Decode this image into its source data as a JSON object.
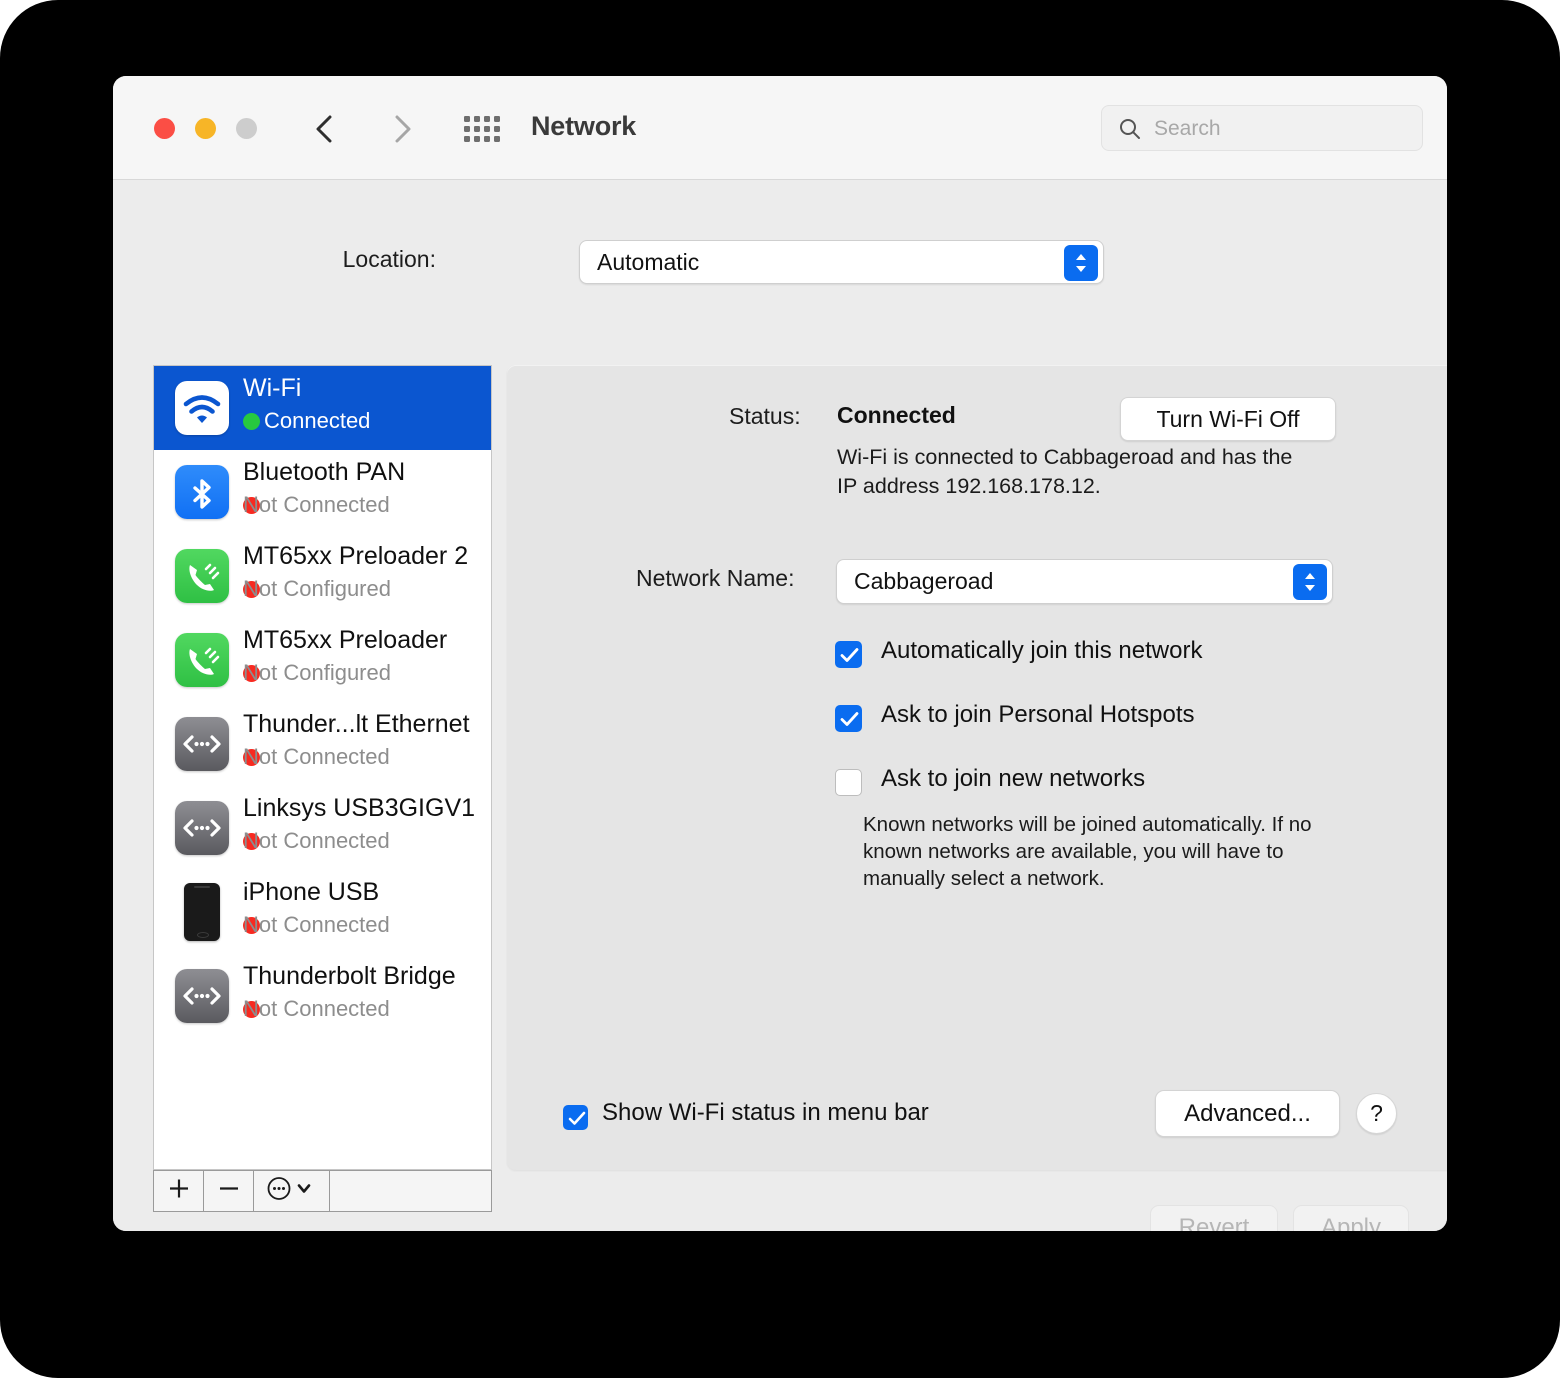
{
  "window": {
    "title": "Network",
    "traffic_lights": [
      "close",
      "minimize",
      "zoom"
    ],
    "accent_color": "#0a6cf0",
    "selection_color": "#0b56d0"
  },
  "search": {
    "placeholder": "Search",
    "value": ""
  },
  "location": {
    "label": "Location:",
    "value": "Automatic"
  },
  "sidebar": {
    "services": [
      {
        "name": "Wi-Fi",
        "status": "Connected",
        "status_color": "#27c93f",
        "icon": "wifi-icon",
        "selected": true
      },
      {
        "name": "Bluetooth PAN",
        "status": "Not Connected",
        "status_color": "#f72a21",
        "icon": "bluetooth-icon",
        "selected": false
      },
      {
        "name": "MT65xx Preloader 2",
        "status": "Not Configured",
        "status_color": "#f72a21",
        "icon": "phone-modem-icon",
        "selected": false
      },
      {
        "name": "MT65xx Preloader",
        "status": "Not Configured",
        "status_color": "#f72a21",
        "icon": "phone-modem-icon",
        "selected": false
      },
      {
        "name": "Thunder...lt Ethernet",
        "status": "Not Connected",
        "status_color": "#f72a21",
        "icon": "ethernet-icon",
        "selected": false
      },
      {
        "name": "Linksys USB3GIGV1",
        "status": "Not Connected",
        "status_color": "#f72a21",
        "icon": "ethernet-icon",
        "selected": false
      },
      {
        "name": "iPhone USB",
        "status": "Not Connected",
        "status_color": "#f72a21",
        "icon": "iphone-icon",
        "selected": false
      },
      {
        "name": "Thunderbolt Bridge",
        "status": "Not Connected",
        "status_color": "#f72a21",
        "icon": "ethernet-icon",
        "selected": false
      }
    ],
    "toolbar": {
      "add_label": "+",
      "remove_label": "−",
      "actions_label": "⋯"
    }
  },
  "panel": {
    "status_label": "Status:",
    "status_value": "Connected",
    "turn_off_button": "Turn Wi-Fi Off",
    "status_description": "Wi-Fi is connected to Cabbageroad and has the IP address 192.168.178.12.",
    "network_name_label": "Network Name:",
    "network_name_value": "Cabbageroad",
    "checkboxes": [
      {
        "label": "Automatically join this network",
        "checked": true
      },
      {
        "label": "Ask to join Personal Hotspots",
        "checked": true
      },
      {
        "label": "Ask to join new networks",
        "checked": false
      }
    ],
    "checkbox_note": "Known networks will be joined automatically. If no known networks are available, you will have to manually select a network.",
    "menu_bar_checkbox": {
      "label": "Show Wi-Fi status in menu bar",
      "checked": true
    },
    "advanced_button": "Advanced...",
    "help_button": "?"
  },
  "footer": {
    "revert_button": "Revert",
    "apply_button": "Apply"
  }
}
